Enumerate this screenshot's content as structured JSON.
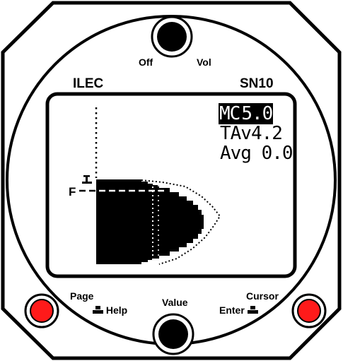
{
  "device": {
    "brand": "ILEC",
    "model": "SN10"
  },
  "controls": {
    "off_label": "Off",
    "vol_label": "Vol",
    "page_label": "Page",
    "help_label": "Help",
    "value_label": "Value",
    "cursor_label": "Cursor",
    "enter_label": "Enter"
  },
  "display": {
    "mc_label": "MC",
    "mc_value": "5.0",
    "tav_label": "TAv",
    "tav_value": "4.2",
    "avg_label": "Avg",
    "avg_value": "0.0",
    "marker_f": "F"
  },
  "colors": {
    "button_red": "#ff1a1a",
    "panel": "#ffffff",
    "ink": "#000000"
  },
  "icons": {
    "knob_top": "knob-icon",
    "knob_bottom": "knob-icon",
    "left_button": "red-button-icon",
    "right_button": "red-button-icon"
  }
}
